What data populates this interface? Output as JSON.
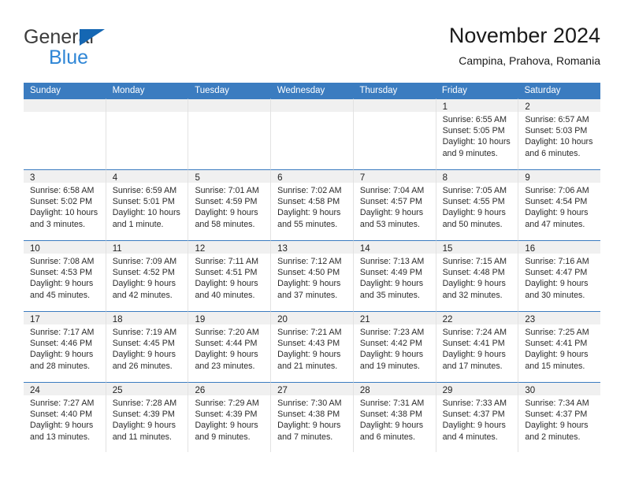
{
  "brand": {
    "name_top": "General",
    "name_bottom": "Blue",
    "triangle_icon": "blue-triangle-icon",
    "color_dark": "#3c3c3c",
    "color_blue": "#2f86d6"
  },
  "header": {
    "title": "November 2024",
    "subtitle": "Campina, Prahova, Romania"
  },
  "theme": {
    "header_blue": "#3b7cc0",
    "band_gray": "#f0f0f0",
    "cell_border": "#e2e2e2"
  },
  "weekdays": [
    "Sunday",
    "Monday",
    "Tuesday",
    "Wednesday",
    "Thursday",
    "Friday",
    "Saturday"
  ],
  "weeks": [
    [
      {
        "day": "",
        "empty": true
      },
      {
        "day": "",
        "empty": true
      },
      {
        "day": "",
        "empty": true
      },
      {
        "day": "",
        "empty": true
      },
      {
        "day": "",
        "empty": true
      },
      {
        "day": "1",
        "sunrise": "Sunrise: 6:55 AM",
        "sunset": "Sunset: 5:05 PM",
        "daylight1": "Daylight: 10 hours",
        "daylight2": "and 9 minutes."
      },
      {
        "day": "2",
        "sunrise": "Sunrise: 6:57 AM",
        "sunset": "Sunset: 5:03 PM",
        "daylight1": "Daylight: 10 hours",
        "daylight2": "and 6 minutes."
      }
    ],
    [
      {
        "day": "3",
        "sunrise": "Sunrise: 6:58 AM",
        "sunset": "Sunset: 5:02 PM",
        "daylight1": "Daylight: 10 hours",
        "daylight2": "and 3 minutes."
      },
      {
        "day": "4",
        "sunrise": "Sunrise: 6:59 AM",
        "sunset": "Sunset: 5:01 PM",
        "daylight1": "Daylight: 10 hours",
        "daylight2": "and 1 minute."
      },
      {
        "day": "5",
        "sunrise": "Sunrise: 7:01 AM",
        "sunset": "Sunset: 4:59 PM",
        "daylight1": "Daylight: 9 hours",
        "daylight2": "and 58 minutes."
      },
      {
        "day": "6",
        "sunrise": "Sunrise: 7:02 AM",
        "sunset": "Sunset: 4:58 PM",
        "daylight1": "Daylight: 9 hours",
        "daylight2": "and 55 minutes."
      },
      {
        "day": "7",
        "sunrise": "Sunrise: 7:04 AM",
        "sunset": "Sunset: 4:57 PM",
        "daylight1": "Daylight: 9 hours",
        "daylight2": "and 53 minutes."
      },
      {
        "day": "8",
        "sunrise": "Sunrise: 7:05 AM",
        "sunset": "Sunset: 4:55 PM",
        "daylight1": "Daylight: 9 hours",
        "daylight2": "and 50 minutes."
      },
      {
        "day": "9",
        "sunrise": "Sunrise: 7:06 AM",
        "sunset": "Sunset: 4:54 PM",
        "daylight1": "Daylight: 9 hours",
        "daylight2": "and 47 minutes."
      }
    ],
    [
      {
        "day": "10",
        "sunrise": "Sunrise: 7:08 AM",
        "sunset": "Sunset: 4:53 PM",
        "daylight1": "Daylight: 9 hours",
        "daylight2": "and 45 minutes."
      },
      {
        "day": "11",
        "sunrise": "Sunrise: 7:09 AM",
        "sunset": "Sunset: 4:52 PM",
        "daylight1": "Daylight: 9 hours",
        "daylight2": "and 42 minutes."
      },
      {
        "day": "12",
        "sunrise": "Sunrise: 7:11 AM",
        "sunset": "Sunset: 4:51 PM",
        "daylight1": "Daylight: 9 hours",
        "daylight2": "and 40 minutes."
      },
      {
        "day": "13",
        "sunrise": "Sunrise: 7:12 AM",
        "sunset": "Sunset: 4:50 PM",
        "daylight1": "Daylight: 9 hours",
        "daylight2": "and 37 minutes."
      },
      {
        "day": "14",
        "sunrise": "Sunrise: 7:13 AM",
        "sunset": "Sunset: 4:49 PM",
        "daylight1": "Daylight: 9 hours",
        "daylight2": "and 35 minutes."
      },
      {
        "day": "15",
        "sunrise": "Sunrise: 7:15 AM",
        "sunset": "Sunset: 4:48 PM",
        "daylight1": "Daylight: 9 hours",
        "daylight2": "and 32 minutes."
      },
      {
        "day": "16",
        "sunrise": "Sunrise: 7:16 AM",
        "sunset": "Sunset: 4:47 PM",
        "daylight1": "Daylight: 9 hours",
        "daylight2": "and 30 minutes."
      }
    ],
    [
      {
        "day": "17",
        "sunrise": "Sunrise: 7:17 AM",
        "sunset": "Sunset: 4:46 PM",
        "daylight1": "Daylight: 9 hours",
        "daylight2": "and 28 minutes."
      },
      {
        "day": "18",
        "sunrise": "Sunrise: 7:19 AM",
        "sunset": "Sunset: 4:45 PM",
        "daylight1": "Daylight: 9 hours",
        "daylight2": "and 26 minutes."
      },
      {
        "day": "19",
        "sunrise": "Sunrise: 7:20 AM",
        "sunset": "Sunset: 4:44 PM",
        "daylight1": "Daylight: 9 hours",
        "daylight2": "and 23 minutes."
      },
      {
        "day": "20",
        "sunrise": "Sunrise: 7:21 AM",
        "sunset": "Sunset: 4:43 PM",
        "daylight1": "Daylight: 9 hours",
        "daylight2": "and 21 minutes."
      },
      {
        "day": "21",
        "sunrise": "Sunrise: 7:23 AM",
        "sunset": "Sunset: 4:42 PM",
        "daylight1": "Daylight: 9 hours",
        "daylight2": "and 19 minutes."
      },
      {
        "day": "22",
        "sunrise": "Sunrise: 7:24 AM",
        "sunset": "Sunset: 4:41 PM",
        "daylight1": "Daylight: 9 hours",
        "daylight2": "and 17 minutes."
      },
      {
        "day": "23",
        "sunrise": "Sunrise: 7:25 AM",
        "sunset": "Sunset: 4:41 PM",
        "daylight1": "Daylight: 9 hours",
        "daylight2": "and 15 minutes."
      }
    ],
    [
      {
        "day": "24",
        "sunrise": "Sunrise: 7:27 AM",
        "sunset": "Sunset: 4:40 PM",
        "daylight1": "Daylight: 9 hours",
        "daylight2": "and 13 minutes."
      },
      {
        "day": "25",
        "sunrise": "Sunrise: 7:28 AM",
        "sunset": "Sunset: 4:39 PM",
        "daylight1": "Daylight: 9 hours",
        "daylight2": "and 11 minutes."
      },
      {
        "day": "26",
        "sunrise": "Sunrise: 7:29 AM",
        "sunset": "Sunset: 4:39 PM",
        "daylight1": "Daylight: 9 hours",
        "daylight2": "and 9 minutes."
      },
      {
        "day": "27",
        "sunrise": "Sunrise: 7:30 AM",
        "sunset": "Sunset: 4:38 PM",
        "daylight1": "Daylight: 9 hours",
        "daylight2": "and 7 minutes."
      },
      {
        "day": "28",
        "sunrise": "Sunrise: 7:31 AM",
        "sunset": "Sunset: 4:38 PM",
        "daylight1": "Daylight: 9 hours",
        "daylight2": "and 6 minutes."
      },
      {
        "day": "29",
        "sunrise": "Sunrise: 7:33 AM",
        "sunset": "Sunset: 4:37 PM",
        "daylight1": "Daylight: 9 hours",
        "daylight2": "and 4 minutes."
      },
      {
        "day": "30",
        "sunrise": "Sunrise: 7:34 AM",
        "sunset": "Sunset: 4:37 PM",
        "daylight1": "Daylight: 9 hours",
        "daylight2": "and 2 minutes."
      }
    ]
  ]
}
